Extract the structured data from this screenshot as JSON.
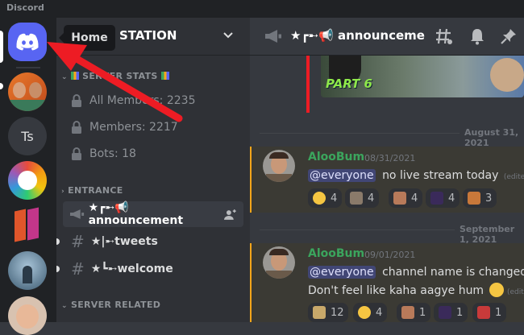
{
  "app": {
    "title": "Discord"
  },
  "tooltip": {
    "label": "Home"
  },
  "guilds": {
    "home_icon": "discord-logo-icon",
    "ts_label": "Ts"
  },
  "server": {
    "name": "STATION",
    "categories": {
      "stats": "SERVER STATS",
      "entrance": "ENTRANCE",
      "related": "SERVER RELATED"
    },
    "stats": [
      {
        "label": "All Members: 2235"
      },
      {
        "label": "Members: 2217"
      },
      {
        "label": "Bots: 18"
      }
    ],
    "channels": [
      {
        "label": "★┏➸📢 announcement"
      },
      {
        "label": "★|➸tweets"
      },
      {
        "label": "★┗➸welcome"
      }
    ]
  },
  "chat": {
    "channel_name": "★┏➸📢 announcement",
    "embed_text": "PART 6",
    "dividers": [
      "August 31, 2021",
      "September 1, 2021"
    ],
    "messages": [
      {
        "author": "AlooBum",
        "timestamp": "08/31/2021",
        "mention": "@everyone",
        "text": "no live stream today",
        "edited": "(edited)",
        "reactions": [
          {
            "emoji": "joy-emoji",
            "count": "4"
          },
          {
            "emoji": "cat-emoji",
            "count": "4"
          },
          {
            "emoji": "face-emoji",
            "count": "4"
          },
          {
            "emoji": "dance-emoji",
            "count": "4"
          },
          {
            "emoji": "wave-emoji",
            "count": "3"
          }
        ]
      },
      {
        "author": "AlooBum",
        "timestamp": "09/01/2021",
        "mention": "@everyone",
        "text": "channel name is changed to",
        "text2": "Don't feel like kaha aagye hum",
        "edited": "(edited)",
        "reactions": [
          {
            "emoji": "cool-emoji",
            "count": "12"
          },
          {
            "emoji": "joy-emoji",
            "count": "4"
          },
          {
            "emoji": "face-emoji",
            "count": "1"
          },
          {
            "emoji": "dance-emoji",
            "count": "1"
          },
          {
            "emoji": "car-emoji",
            "count": "1"
          }
        ]
      }
    ]
  },
  "colors": {
    "blurple": "#5865f2",
    "arrow": "#ed1c24",
    "author": "#3ba55d",
    "mention_highlight": "#faa61a"
  }
}
